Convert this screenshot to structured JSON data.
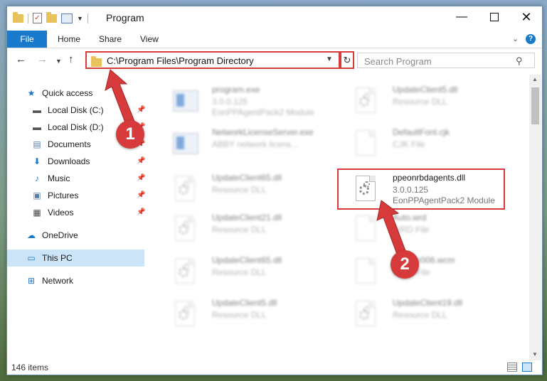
{
  "window": {
    "title": "Program",
    "controls": {
      "minimize": "—",
      "maximize": "",
      "close": "✕"
    }
  },
  "ribbon": {
    "tabs": [
      "File",
      "Home",
      "Share",
      "View"
    ],
    "chevron": "⌄",
    "help": "?"
  },
  "address": {
    "path": "C:\\Program Files\\Program Directory",
    "search_placeholder": "Search Program"
  },
  "sidebar": {
    "items": [
      {
        "label": "Quick access",
        "icon": "star-icon",
        "glyph": "★",
        "color": "#1979ca",
        "pinned": false
      },
      {
        "label": "Local Disk (C:)",
        "icon": "drive-icon",
        "glyph": "▬",
        "color": "#555555",
        "pinned": true
      },
      {
        "label": "Local Disk (D:)",
        "icon": "drive-icon",
        "glyph": "▬",
        "color": "#555555",
        "pinned": true
      },
      {
        "label": "Documents",
        "icon": "documents-icon",
        "glyph": "▤",
        "color": "#5a7ea8",
        "pinned": true
      },
      {
        "label": "Downloads",
        "icon": "download-icon",
        "glyph": "⬇",
        "color": "#1979ca",
        "pinned": true
      },
      {
        "label": "Music",
        "icon": "music-icon",
        "glyph": "♪",
        "color": "#1979ca",
        "pinned": true
      },
      {
        "label": "Pictures",
        "icon": "pictures-icon",
        "glyph": "▣",
        "color": "#5a7ea8",
        "pinned": true
      },
      {
        "label": "Videos",
        "icon": "videos-icon",
        "glyph": "▦",
        "color": "#444444",
        "pinned": true
      },
      {
        "label": "OneDrive",
        "icon": "cloud-icon",
        "glyph": "☁",
        "color": "#1979ca",
        "pinned": false
      },
      {
        "label": "This PC",
        "icon": "computer-icon",
        "glyph": "▭",
        "color": "#1979ca",
        "pinned": false,
        "selected": true
      },
      {
        "label": "Network",
        "icon": "network-icon",
        "glyph": "⊞",
        "color": "#1979ca",
        "pinned": false
      }
    ],
    "pin_glyph": "📌"
  },
  "files": [
    {
      "name": "program.exe",
      "type": "3.0.0.125",
      "desc": "EonPPAgentPack2 Module",
      "icon": "exe-icon",
      "blurred": true
    },
    {
      "name": "UpdateClient5.dll",
      "type": "Resource DLL",
      "desc": "",
      "icon": "dll-icon",
      "blurred": true
    },
    {
      "name": "NetworkLicenseServer.exe",
      "type": "ABBY network licens...",
      "desc": "",
      "icon": "exe-icon",
      "blurred": true
    },
    {
      "name": "DefaultFont.cjk",
      "type": "CJK File",
      "desc": "",
      "icon": "file-icon",
      "blurred": true
    },
    {
      "name": "UpdateClient65.dll",
      "type": "Resource DLL",
      "desc": "",
      "icon": "dll-icon",
      "blurred": true
    },
    {
      "name": "ppeonrbdagents.dll",
      "type": "3.0.0.125",
      "desc": "EonPPAgentPack2 Module",
      "icon": "dll-icon",
      "blurred": false
    },
    {
      "name": "UpdateClient21.dll",
      "type": "Resource DLL",
      "desc": "",
      "icon": "dll-icon",
      "blurred": true
    },
    {
      "name": "Auto.wrd",
      "type": "WRD File",
      "desc": "",
      "icon": "file-icon",
      "blurred": true
    },
    {
      "name": "UpdateClient65.dll",
      "type": "Resource DLL",
      "desc": "",
      "icon": "dll-icon",
      "blurred": true
    },
    {
      "name": "SndScr006.wcm",
      "type": "WCM File",
      "desc": "",
      "icon": "file-icon",
      "blurred": true
    },
    {
      "name": "UpdateClient5.dll",
      "type": "Resource DLL",
      "desc": "",
      "icon": "dll-icon",
      "blurred": true
    },
    {
      "name": "UpdateClient19.dll",
      "type": "Resource DLL",
      "desc": "",
      "icon": "dll-icon",
      "blurred": true
    }
  ],
  "status": {
    "item_count": "146 items"
  },
  "annotations": {
    "step1": "1",
    "step2": "2",
    "color": "#d63a3a"
  }
}
